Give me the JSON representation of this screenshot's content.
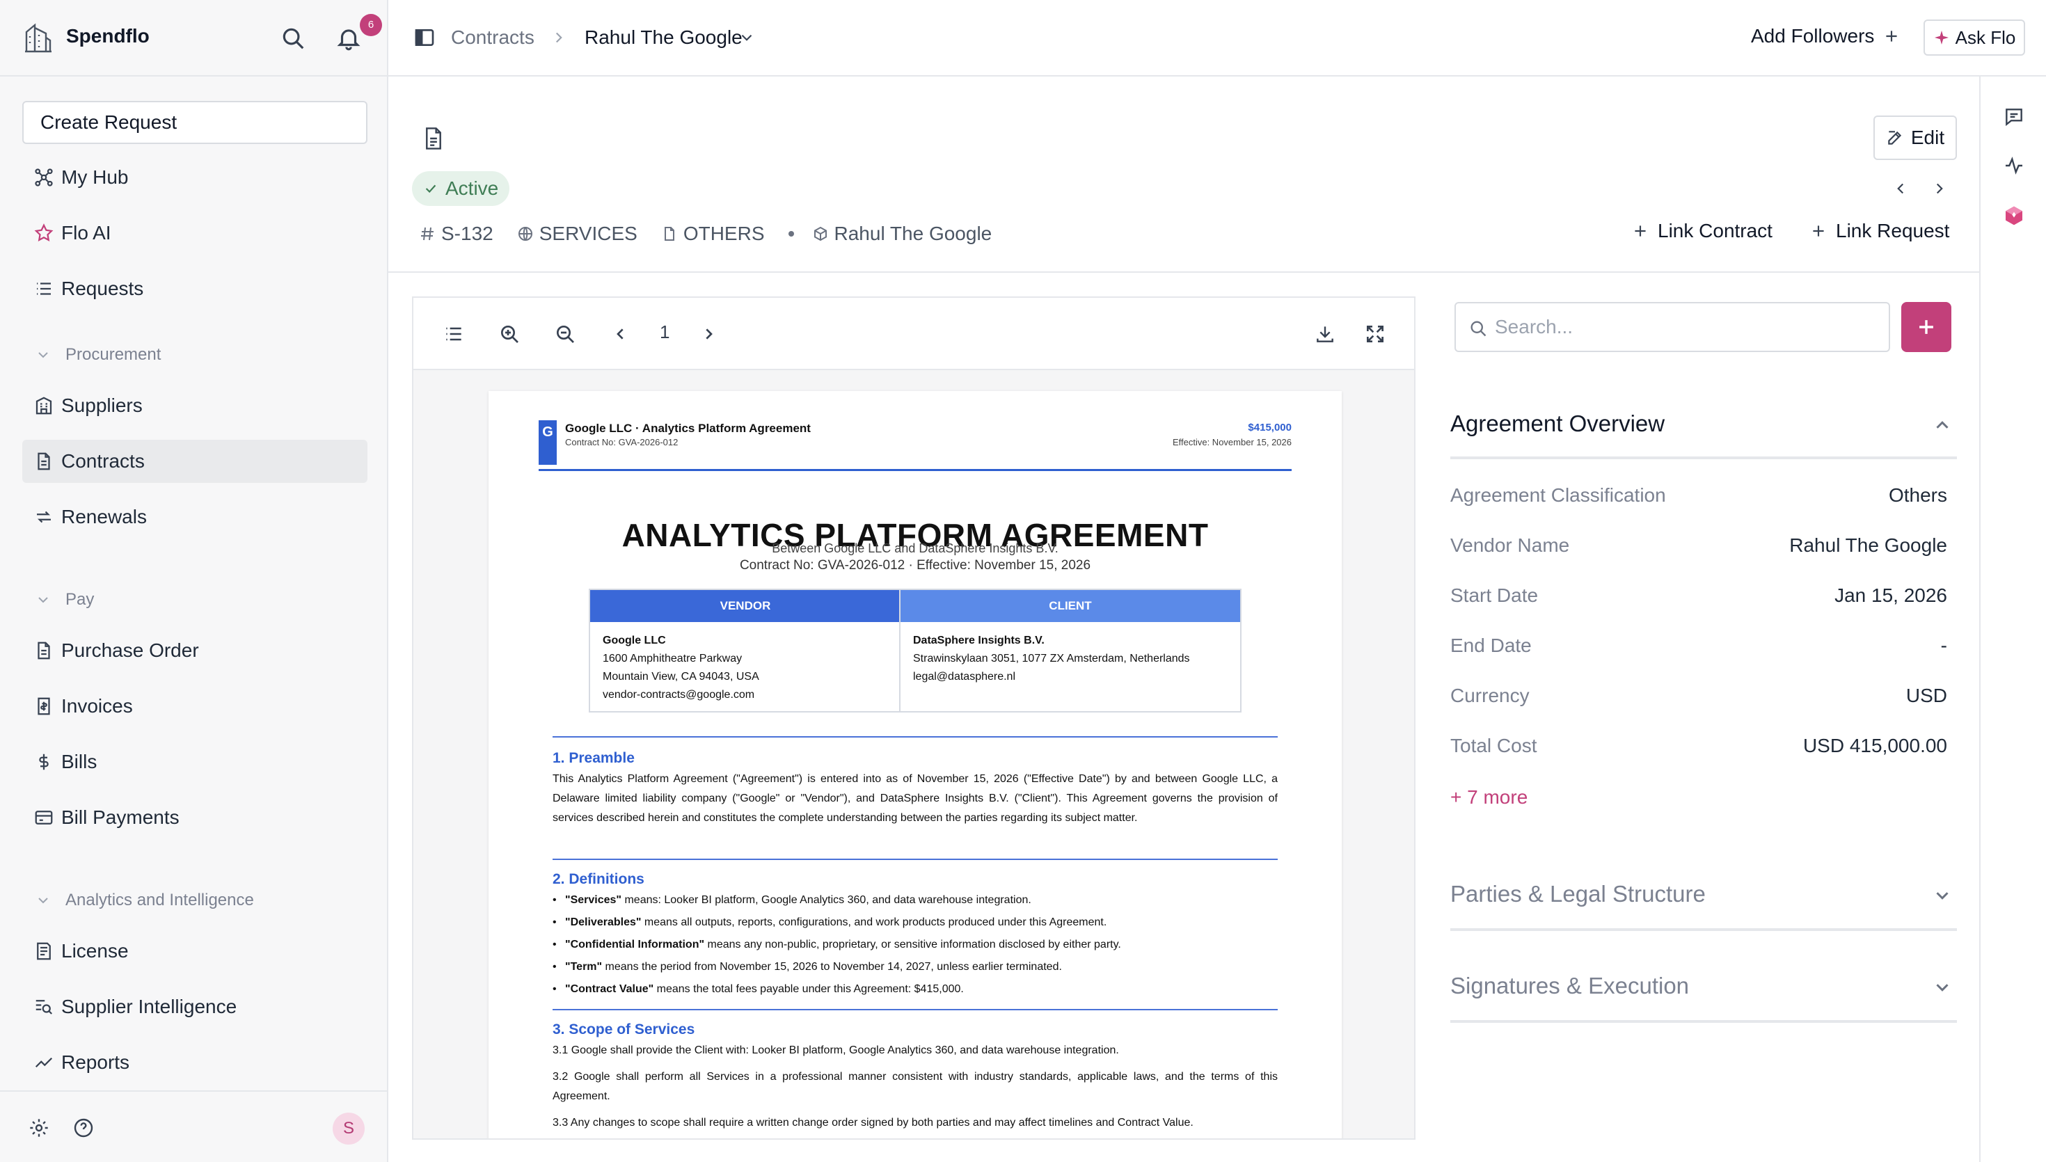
{
  "app": {
    "name": "Spendflo",
    "notification_count": "6",
    "user_initial": "S"
  },
  "sidebar": {
    "create_request": "Create Request",
    "items_top": [
      {
        "label": "My Hub",
        "icon": "hub-icon"
      },
      {
        "label": "Flo AI",
        "icon": "star-icon"
      },
      {
        "label": "Requests",
        "icon": "list-icon"
      }
    ],
    "sections": [
      {
        "label": "Procurement",
        "items": [
          {
            "label": "Suppliers",
            "icon": "building-icon"
          },
          {
            "label": "Contracts",
            "icon": "document-icon",
            "active": true
          },
          {
            "label": "Renewals",
            "icon": "refresh-icon"
          }
        ]
      },
      {
        "label": "Pay",
        "items": [
          {
            "label": "Purchase Order",
            "icon": "document-icon"
          },
          {
            "label": "Invoices",
            "icon": "receipt-icon"
          },
          {
            "label": "Bills",
            "icon": "dollar-icon"
          },
          {
            "label": "Bill Payments",
            "icon": "card-icon"
          }
        ]
      },
      {
        "label": "Analytics and Intelligence",
        "items": [
          {
            "label": "License",
            "icon": "license-icon"
          },
          {
            "label": "Supplier Intelligence",
            "icon": "search-list-icon"
          },
          {
            "label": "Reports",
            "icon": "trend-icon"
          }
        ]
      }
    ]
  },
  "topbar": {
    "breadcrumb_root": "Contracts",
    "breadcrumb_current": "Rahul The Google",
    "add_followers": "Add Followers",
    "ask_flo": "Ask Flo"
  },
  "contract": {
    "status": "Active",
    "id": "S-132",
    "category": "SERVICES",
    "type": "OTHERS",
    "vendor": "Rahul The Google",
    "edit": "Edit",
    "link_contract": "Link Contract",
    "link_request": "Link Request"
  },
  "viewer": {
    "page_number": "1",
    "doc": {
      "header_title": "Google LLC  ·  Analytics Platform Agreement",
      "header_contract": "Contract No: GVA-2026-012",
      "header_amount": "$415,000",
      "header_effective": "Effective: November 15, 2026",
      "logo_letter": "G",
      "title": "ANALYTICS PLATFORM AGREEMENT",
      "between": "Between Google LLC and DataSphere Insights B.V.",
      "contract_line": "Contract No: GVA-2026-012 · Effective: November 15, 2026",
      "vendor_header": "VENDOR",
      "client_header": "CLIENT",
      "vendor_name": "Google LLC",
      "vendor_addr1": "1600 Amphitheatre Parkway",
      "vendor_addr2": "Mountain View, CA 94043, USA",
      "vendor_email": "vendor-contracts@google.com",
      "client_name": "DataSphere Insights B.V.",
      "client_addr1": "Strawinskylaan 3051, 1077 ZX Amsterdam, Netherlands",
      "client_email": "legal@datasphere.nl",
      "s1_title": "1. Preamble",
      "s1_text": "This Analytics Platform Agreement (\"Agreement\") is entered into as of November 15, 2026 (\"Effective Date\") by and between Google LLC, a Delaware limited liability company (\"Google\" or \"Vendor\"), and DataSphere Insights B.V. (\"Client\"). This Agreement governs the provision of services described herein and constitutes the complete understanding between the parties regarding its subject matter.",
      "s2_title": "2. Definitions",
      "definitions": [
        {
          "term": "\"Services\"",
          "text": " means: Looker BI platform, Google Analytics 360, and data warehouse integration."
        },
        {
          "term": "\"Deliverables\"",
          "text": " means all outputs, reports, configurations, and work products produced under this Agreement."
        },
        {
          "term": "\"Confidential Information\"",
          "text": " means any non-public, proprietary, or sensitive information disclosed by either party."
        },
        {
          "term": "\"Term\"",
          "text": " means the period from November 15, 2026 to November 14, 2027, unless earlier terminated."
        },
        {
          "term": "\"Contract Value\"",
          "text": " means the total fees payable under this Agreement: $415,000."
        }
      ],
      "s3_title": "3. Scope of Services",
      "s3_p1": "3.1 Google shall provide the Client with: Looker BI platform, Google Analytics 360, and data warehouse integration.",
      "s3_p2": "3.2 Google shall perform all Services in a professional manner consistent with industry standards, applicable laws, and the terms of this Agreement.",
      "s3_p3": "3.3 Any changes to scope shall require a written change order signed by both parties and may affect timelines and Contract Value."
    }
  },
  "panel": {
    "search_placeholder": "Search...",
    "overview_title": "Agreement Overview",
    "fields": [
      {
        "label": "Agreement Classification",
        "value": "Others"
      },
      {
        "label": "Vendor Name",
        "value": "Rahul The Google"
      },
      {
        "label": "Start Date",
        "value": "Jan 15, 2026"
      },
      {
        "label": "End Date",
        "value": "-"
      },
      {
        "label": "Currency",
        "value": "USD"
      },
      {
        "label": "Total Cost",
        "value": "USD 415,000.00"
      }
    ],
    "more_link": "+ 7 more",
    "section_parties": "Parties & Legal Structure",
    "section_signatures": "Signatures & Execution"
  },
  "colors": {
    "accent": "#c2407a",
    "doc_blue": "#2f5fd0",
    "status_green": "#3f7d55"
  }
}
